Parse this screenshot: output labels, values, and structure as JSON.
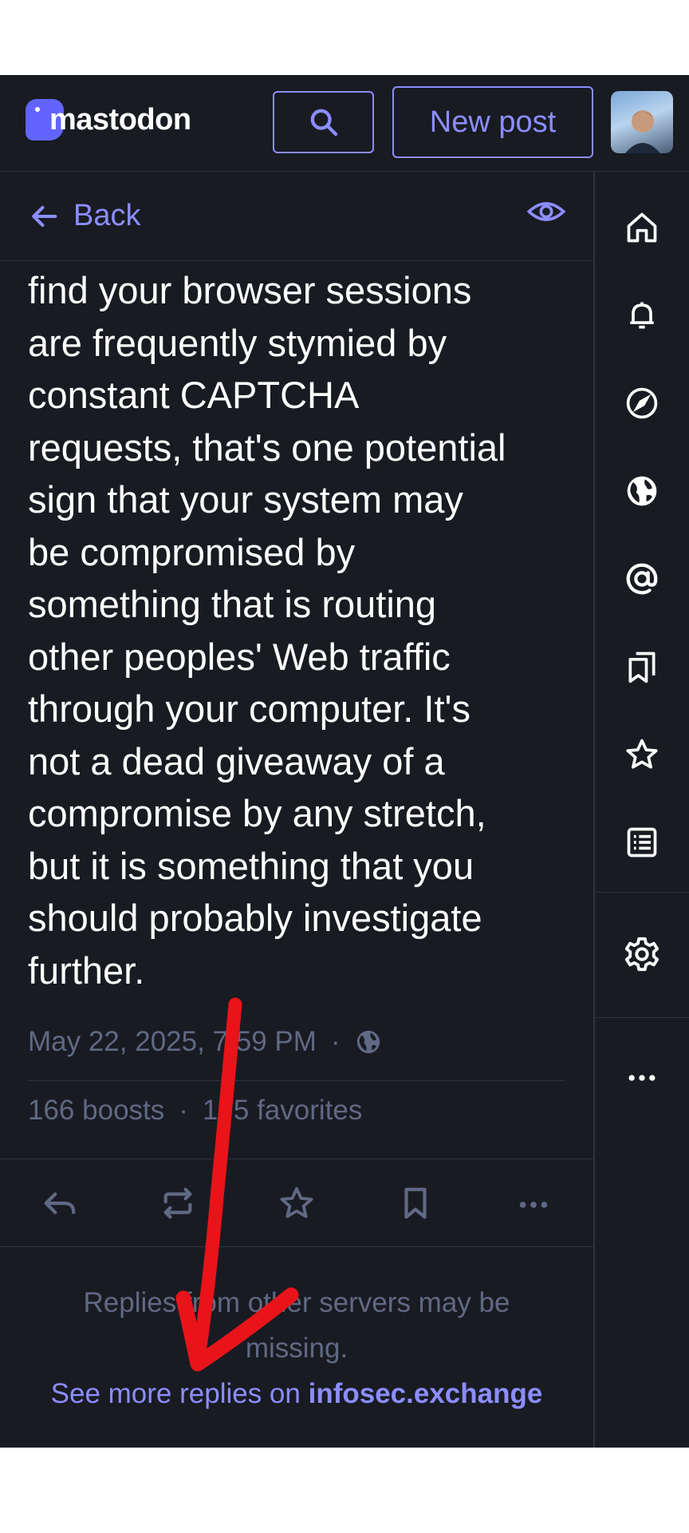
{
  "header": {
    "logo_text": "mastodon",
    "new_post_label": "New post"
  },
  "back_bar": {
    "back_label": "Back"
  },
  "status": {
    "text": "find your browser sessions\nare frequently stymied by\nconstant CAPTCHA\nrequests, that's one potential\nsign that your system may\nbe compromised by\nsomething that is routing\nother peoples' Web traffic\nthrough your computer. It's\nnot a dead giveaway of a\ncompromise by any stretch,\nbut it is something that you\nshould probably investigate\nfurther.",
    "date": "May 22, 2025, 7:59 PM",
    "boosts_count": "166",
    "boosts_label": "boosts",
    "favorites_count": "175",
    "favorites_label": "favorites"
  },
  "replies": {
    "note": "Replies from other servers may be missing.",
    "see_more_prefix": "See more replies on",
    "see_more_domain": "infosec.exchange"
  },
  "icons": {
    "search": "search-icon",
    "back": "arrow-left-icon",
    "visibility": "eye-icon",
    "globe": "globe-icon",
    "reply": "reply-icon",
    "boost": "boost-icon",
    "favorite": "star-icon",
    "bookmark": "bookmark-icon",
    "more": "more-icon"
  },
  "nav": [
    "home-icon",
    "notifications-icon",
    "explore-icon",
    "live-feeds-icon",
    "mentions-icon",
    "bookmarks-icon",
    "favorites-icon",
    "lists-icon",
    "preferences-icon",
    "more-icon"
  ],
  "colors": {
    "background": "#191b22",
    "accent": "#8c8dff",
    "muted": "#606984",
    "annotation": "#e8141a"
  }
}
